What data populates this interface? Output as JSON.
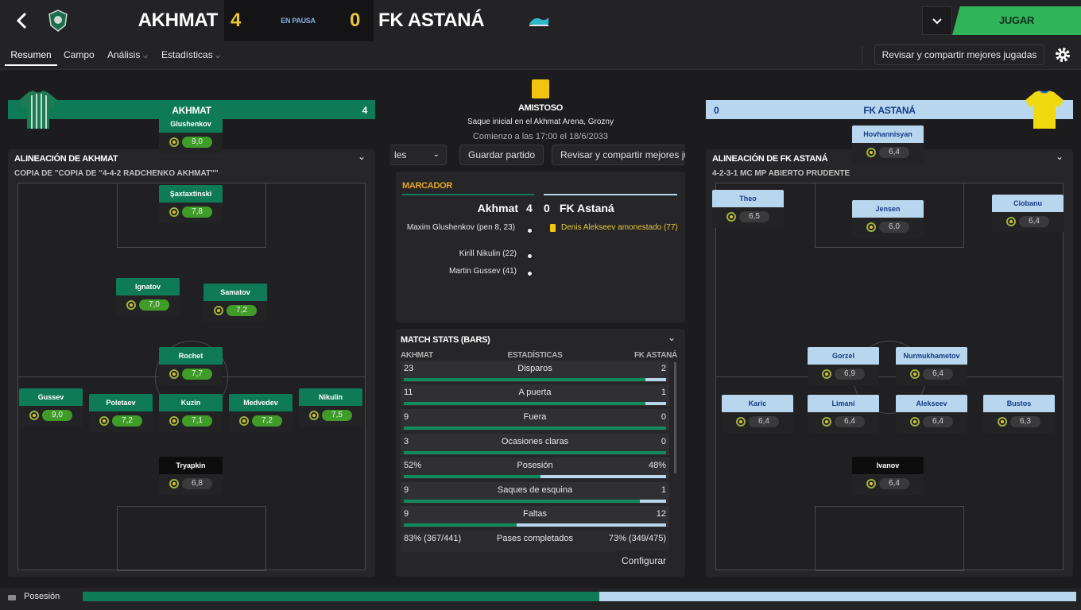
{
  "header": {
    "home_team": "AKHMAT",
    "home_score": "4",
    "status": "EN PAUSA",
    "away_score": "0",
    "away_team": "FK ASTANÁ",
    "play_label": "JUGAR"
  },
  "tabs": [
    {
      "label": "Resumen"
    },
    {
      "label": "Campo"
    },
    {
      "label": "Análisis"
    },
    {
      "label": "Estadísticas"
    }
  ],
  "review_button": "Revisar y compartir mejores jugadas",
  "home_banner": {
    "name": "AKHMAT",
    "score": "4"
  },
  "away_banner": {
    "name": "FK ASTANÁ",
    "score": "0"
  },
  "match_info": {
    "competition": "AMISTOSO",
    "kickoff": "Saque inicial en el Akhmat Arena, Grozny",
    "start": "Comienzo a las 17:00 el 18/6/2033"
  },
  "center_buttons": {
    "partial": "les",
    "save": "Guardar partido",
    "review": "Revisar y compartir mejores ju"
  },
  "scoreboard": {
    "title": "MARCADOR",
    "home": "Akhmat",
    "home_score": "4",
    "away_score": "0",
    "away": "FK Astaná",
    "home_events": [
      {
        "text": "Maxim Glushenkov (pen 8, 23)"
      },
      {
        "text": "Kirill Nikulin (22)"
      },
      {
        "text": "Martin Gussev (41)"
      }
    ],
    "away_events": [
      {
        "text": "Denis Alekseev amonestado (77)"
      }
    ]
  },
  "stats": {
    "title": "MATCH STATS (BARS)",
    "home_label": "AKHMAT",
    "mid_label": "ESTADÍSTICAS",
    "away_label": "FK ASTANÁ",
    "rows": [
      {
        "home": "23",
        "name": "Disparos",
        "away": "2",
        "home_frac": 0.92
      },
      {
        "home": "11",
        "name": "A puerta",
        "away": "1",
        "home_frac": 0.92
      },
      {
        "home": "9",
        "name": "Fuera",
        "away": "0",
        "home_frac": 1.0
      },
      {
        "home": "3",
        "name": "Ocasiones claras",
        "away": "0",
        "home_frac": 1.0
      },
      {
        "home": "52%",
        "name": "Posesión",
        "away": "48%",
        "home_frac": 0.52
      },
      {
        "home": "9",
        "name": "Saques de esquina",
        "away": "1",
        "home_frac": 0.9
      },
      {
        "home": "9",
        "name": "Faltas",
        "away": "12",
        "home_frac": 0.43
      }
    ],
    "passes": {
      "home": "83% (367/441)",
      "name": "Pases completados",
      "away": "73% (349/475)"
    },
    "configure": "Configurar"
  },
  "home_lineup": {
    "title": "ALINEACIÓN DE AKHMAT",
    "formation": "COPIA DE \"COPIA DE \"4-4-2 RADCHENKO AKHMAT\"\"",
    "players": [
      {
        "name": "Glushenkov",
        "rating": "9,0"
      },
      {
        "name": "Şaxtaxtinski",
        "rating": "7,8"
      },
      {
        "name": "Ignatov",
        "rating": "7,0"
      },
      {
        "name": "Samatov",
        "rating": "7,2"
      },
      {
        "name": "Rochet",
        "rating": "7,7"
      },
      {
        "name": "Gussev",
        "rating": "9,0"
      },
      {
        "name": "Poletaev",
        "rating": "7,2"
      },
      {
        "name": "Kuzin",
        "rating": "7,1"
      },
      {
        "name": "Medvedev",
        "rating": "7,2"
      },
      {
        "name": "Nikulin",
        "rating": "7,5"
      },
      {
        "name": "Tryapkin",
        "rating": "6,8"
      }
    ]
  },
  "away_lineup": {
    "title": "ALINEACIÓN DE FK ASTANÁ",
    "formation": "4-2-3-1 MC MP ABIERTO PRUDENTE",
    "players": [
      {
        "name": "Hovhannisyan",
        "rating": "6,4"
      },
      {
        "name": "Theo",
        "rating": "6,5"
      },
      {
        "name": "Jensen",
        "rating": "6,0"
      },
      {
        "name": "Ciobanu",
        "rating": "6,4"
      },
      {
        "name": "Gorzel",
        "rating": "6,9"
      },
      {
        "name": "Nurmukhametov",
        "rating": "6,4"
      },
      {
        "name": "Karic",
        "rating": "6,4"
      },
      {
        "name": "Limani",
        "rating": "6,4"
      },
      {
        "name": "Alekseev",
        "rating": "6,4"
      },
      {
        "name": "Bustos",
        "rating": "6,3"
      },
      {
        "name": "Ivanov",
        "rating": "6,4"
      }
    ]
  },
  "footer": {
    "label": "Posesión",
    "home_frac": 0.52
  },
  "colors": {
    "home": "#0f7a56",
    "away": "#b8d7ee",
    "accent": "#2fb45a"
  }
}
